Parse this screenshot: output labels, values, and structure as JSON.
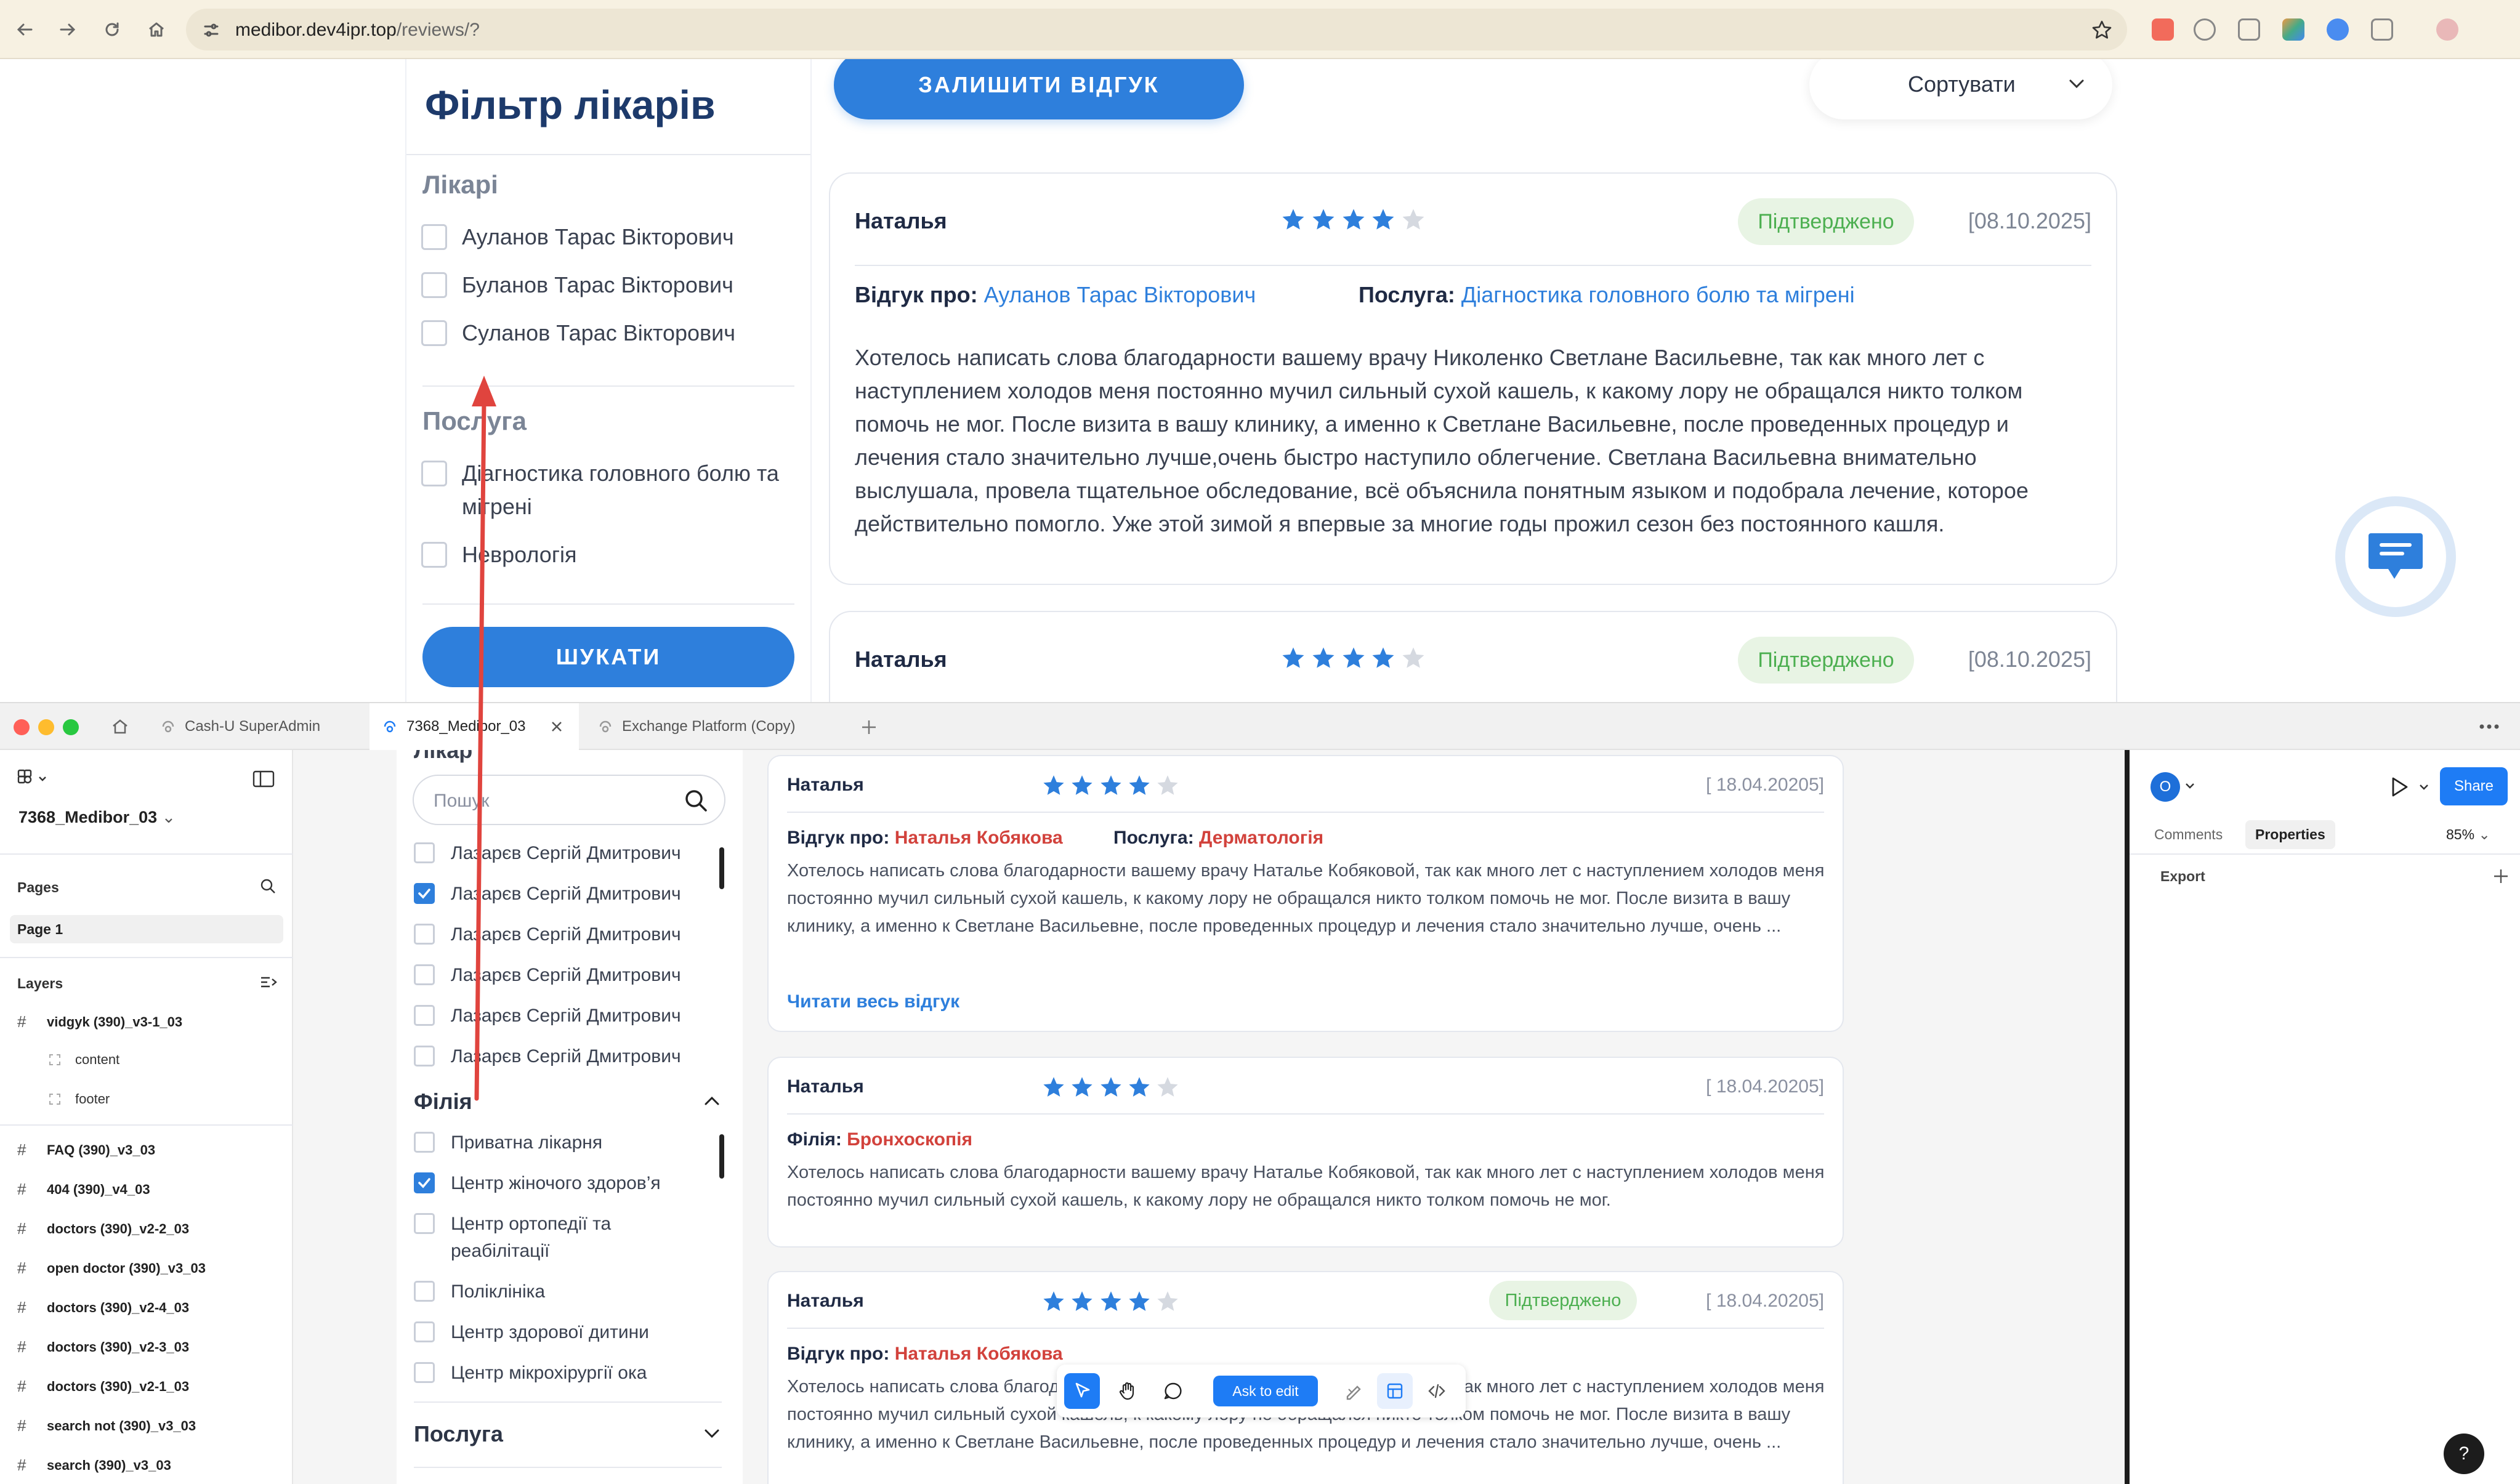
{
  "browser": {
    "url_host": "medibor.dev4ipr.top",
    "url_path": "/reviews/?"
  },
  "site": {
    "filter": {
      "title": "Фільтр лікарів",
      "doctors_heading": "Лікарі",
      "doctors": [
        "Ауланов Тарас Вікторович",
        "Буланов Тарас Вікторович",
        "Суланов Тарас Вікторович"
      ],
      "service_heading": "Послуга",
      "services": [
        "Діагностика головного болю та мігрені",
        "Неврологія"
      ],
      "search_label": "ШУКАТИ"
    },
    "leave_review_label": "ЗАЛИШИТИ ВІДГУК",
    "sort_label": "Сортувати",
    "reviews": [
      {
        "name": "Наталья",
        "rating": 4,
        "badge": "Підтверджено",
        "date": "[08.10.2025]",
        "about_label": "Відгук про:",
        "about": "Ауланов Тарас Вікторович",
        "service_label": "Послуга:",
        "service": "Діагностика головного болю та мігрені",
        "text": "Хотелось написать слова благодарности вашему врачу Николенко Светлане Васильевне, так как много лет с наступлением холодов меня постоянно мучил сильный сухой кашель, к какому лору не обращался никто толком помочь не мог. После визита в вашу клинику, а именно к Светлане Васильевне, после проведенных процедур и лечения стало значительно лучше,очень быстро наступило облегчение. Светлана Васильевна внимательно выслушала, провела тщательное обследование, всё объяснила понятным языком и подобрала лечение, которое действительно помогло. Уже этой зимой я впервые за многие годы прожил сезон без постоянного кашля."
      },
      {
        "name": "Наталья",
        "rating": 4,
        "badge": "Підтверджено",
        "date": "[08.10.2025]"
      }
    ]
  },
  "figma": {
    "tabs": [
      "Cash-U SuperAdmin",
      "7368_Medibor_03",
      "Exchange Platform (Copy)"
    ],
    "file_name": "7368_Medibor_03",
    "pages_label": "Pages",
    "page1": "Page 1",
    "layers_label": "Layers",
    "layers": [
      {
        "name": "vidgyk (390)_v3-1_03",
        "children": [
          "content",
          "footer"
        ]
      },
      {
        "name": "FAQ (390)_v3_03"
      },
      {
        "name": "404 (390)_v4_03"
      },
      {
        "name": "doctors (390)_v2-2_03"
      },
      {
        "name": "open doctor (390)_v3_03"
      },
      {
        "name": "doctors (390)_v2-4_03"
      },
      {
        "name": "doctors (390)_v2-3_03"
      },
      {
        "name": "doctors (390)_v2-1_03"
      },
      {
        "name": "search not (390)_v3_03"
      },
      {
        "name": "search (390)_v3_03"
      }
    ],
    "mockup": {
      "partial_heading": "Лікар",
      "search_placeholder": "Пошук",
      "doctors": [
        {
          "label": "Лазарєв Сергій Дмитрович",
          "checked": false
        },
        {
          "label": "Лазарєв Сергій Дмитрович",
          "checked": true
        },
        {
          "label": "Лазарєв Сергій Дмитрович",
          "checked": false
        },
        {
          "label": "Лазарєв Сергій Дмитрович",
          "checked": false
        },
        {
          "label": "Лазарєв Сергій Дмитрович",
          "checked": false
        },
        {
          "label": "Лазарєв Сергій Дмитрович",
          "checked": false
        }
      ],
      "branch_heading": "Філія",
      "branches": [
        {
          "label": "Приватна лікарня",
          "checked": false
        },
        {
          "label": "Центр жіночого здоров’я",
          "checked": true
        },
        {
          "label": "Центр ортопедії та реабілітації",
          "checked": false
        },
        {
          "label": "Поліклініка",
          "checked": false
        },
        {
          "label": "Центр здорової дитини",
          "checked": false
        },
        {
          "label": "Центр мікрохірургії ока",
          "checked": false
        }
      ],
      "service_heading": "Послуга",
      "cards": [
        {
          "name": "Наталья",
          "rating": 4,
          "date": "[ 18.04.20205]",
          "meta1_label": "Відгук про:",
          "meta1_value": "Наталья Кобякова",
          "meta2_label": "Послуга:",
          "meta2_value": "Дерматологія",
          "text": "Хотелось написать слова благодарности вашему врачу Наталье Кобяковой, так как много лет с наступлением холодов меня постоянно мучил сильный сухой кашель, к какому лору не обращался никто толком помочь не мог. После визита в вашу клинику, а именно к Светлане Васильевне, после проведенных процедур и лечения стало значительно лучше, очень ...",
          "read_more": "Читати весь відгук"
        },
        {
          "name": "Наталья",
          "rating": 4,
          "date": "[ 18.04.20205]",
          "meta1_label": "Філія:",
          "meta1_value": "Бронхоскопія",
          "text": "Хотелось написать слова благодарности вашему врачу Наталье Кобяковой, так как много лет с наступлением холодов меня постоянно мучил сильный сухой кашель, к какому лору не обращался никто толком помочь не мог."
        },
        {
          "name": "Наталья",
          "rating": 4,
          "badge": "Підтверджено",
          "date": "[ 18.04.20205]",
          "meta1_label": "Відгук про:",
          "meta1_value": "Наталья Кобякова",
          "text": "Хотелось написать слова благодарности вашему врачу Наталье Кобяковой, так как много лет с наступлением холодов меня постоянно мучил сильный сухой кашель, к какому лору не обращался никто толком помочь не мог. После визита в вашу клинику, а именно к Светлане Васильевне, после проведенных процедур и лечения стало значительно лучше, очень ..."
        }
      ]
    },
    "toolbar": {
      "ask_to_edit": "Ask to edit"
    },
    "right": {
      "avatar_letter": "O",
      "share_label": "Share",
      "tab_comments": "Comments",
      "tab_properties": "Properties",
      "zoom": "85%",
      "export_label": "Export",
      "help": "?"
    }
  },
  "colors": {
    "accent": "#2e7fdc",
    "badge_green": "#4caf50",
    "link_red": "#d2423c",
    "star": "#2e7fdc",
    "arrow": "#e0443e"
  }
}
